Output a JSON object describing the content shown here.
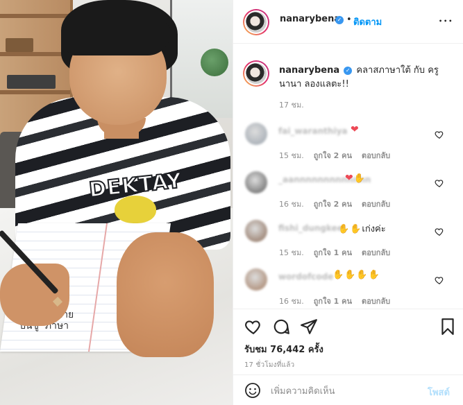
{
  "media": {
    "shirt_print": "DEKTAY",
    "handwriting": "ภ = เซนกาย\nปนชู  ภาษา"
  },
  "header": {
    "username": "nanarybena",
    "separator": "•",
    "follow_label": "ติดตาม",
    "more_label": "•••"
  },
  "caption": {
    "username": "nanarybena",
    "text": "คลาสภาษาใต้ กับ ครูนานา ลองแลตะ!!",
    "time": "17 ชม."
  },
  "comments": [
    {
      "username": "fai_waranthiya",
      "text": "",
      "emoji": [
        "heart-red"
      ],
      "time": "15 ชม.",
      "likes": "ถูกใจ 2 คน",
      "reply": "ตอบกลับ",
      "avatar_color": "#9aa3ad"
    },
    {
      "username": "_aannnnnnnnnnnnn",
      "text": "",
      "emoji": [
        "heart-red",
        "clap"
      ],
      "time": "16 ชม.",
      "likes": "ถูกใจ 2 คน",
      "reply": "ตอบกลับ",
      "avatar_color": "#5c5c5c"
    },
    {
      "username": "fishi_dungkee",
      "text": "เก่งค่ะ",
      "emoji": [
        "clap",
        "clap"
      ],
      "time": "15 ชม.",
      "likes": "ถูกใจ 1 คน",
      "reply": "ตอบกลับ",
      "avatar_color": "#8a6a55"
    },
    {
      "username": "wordofcode",
      "text": "",
      "emoji": [
        "clap",
        "clap",
        "clap",
        "clap"
      ],
      "time": "16 ชม.",
      "likes": "ถูกใจ 1 คน",
      "reply": "ตอบกลับ",
      "avatar_color": "#a27a5f"
    }
  ],
  "actions": {
    "likes_text": "รับชม 76,442 ครั้ง",
    "timestamp": "17 ชั่วโมงที่แล้ว"
  },
  "add_comment": {
    "placeholder": "เพิ่มความคิดเห็น",
    "post_label": "โพสต์"
  },
  "colors": {
    "accent": "#0095f6",
    "post_disabled": "#b2dffc",
    "muted": "#8e8e8e",
    "heart": "#ed4956",
    "clap": "#f6c53b"
  }
}
